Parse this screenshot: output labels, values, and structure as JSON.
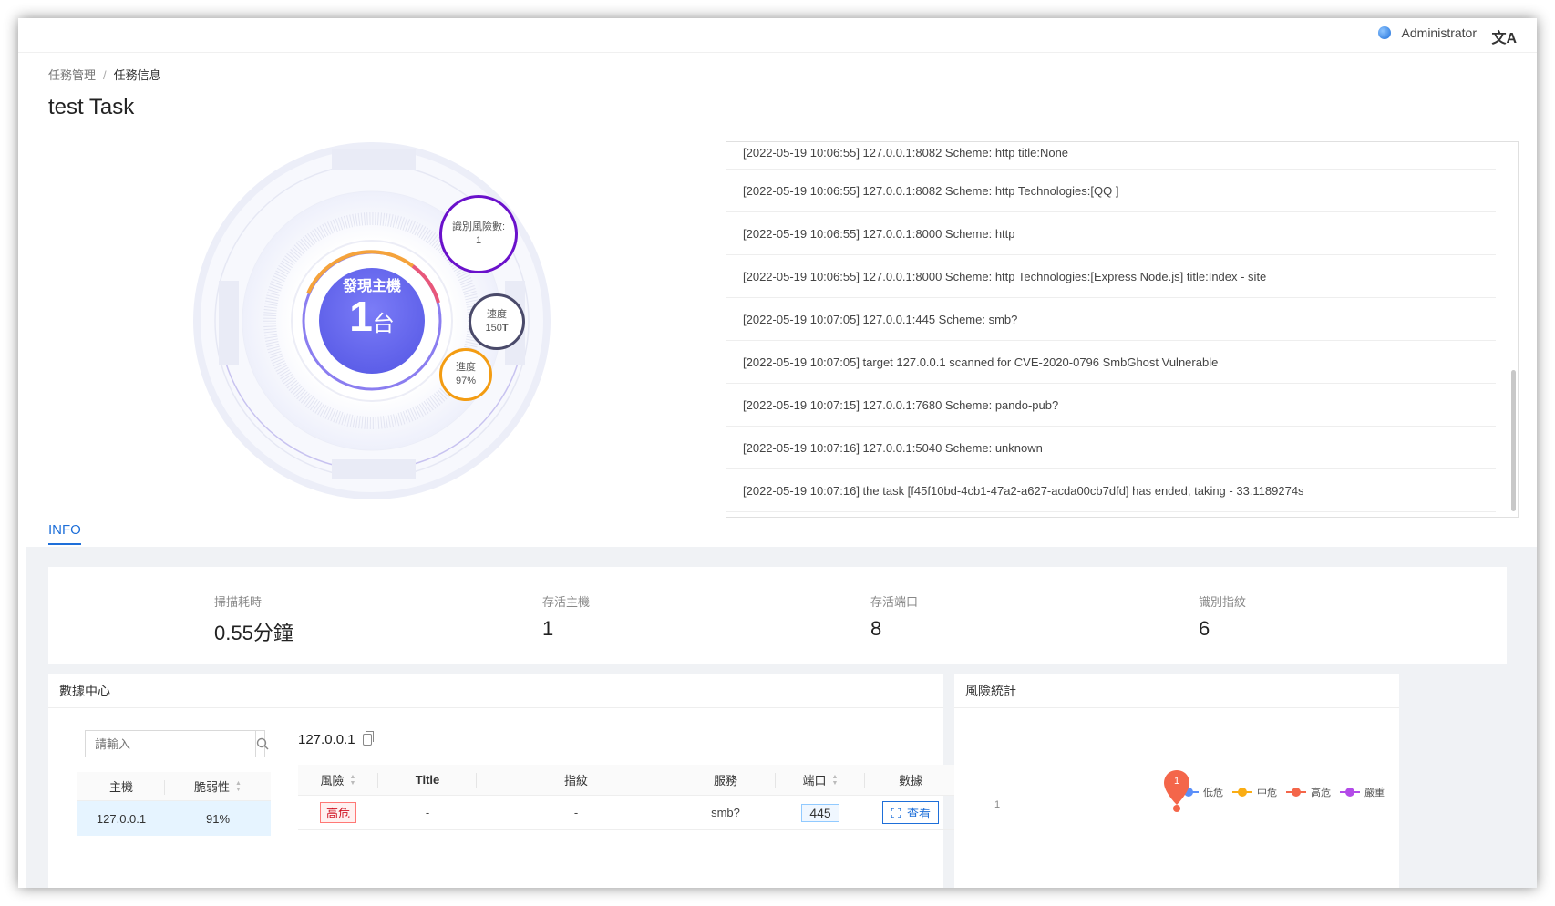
{
  "header": {
    "user": "Administrator",
    "lang_icon": "translate-icon"
  },
  "breadcrumb": {
    "parent": "任務管理",
    "separator": "/",
    "current": "任務信息"
  },
  "page_title": "test Task",
  "gauge": {
    "center_label": "發現主機",
    "center_value": "1",
    "center_unit": "台",
    "risk_label": "識別風險數:",
    "risk_value": "1",
    "speed_label": "速度",
    "speed_value": "150",
    "speed_unit": "T",
    "progress_label": "進度",
    "progress_value": "97%",
    "progress_fraction": 0.97
  },
  "log_lines": [
    "[2022-05-19 10:06:55] 127.0.0.1:8082 Scheme: http title:None",
    "[2022-05-19 10:06:55] 127.0.0.1:8082 Scheme: http Technologies:[QQ ]",
    "[2022-05-19 10:06:55] 127.0.0.1:8000 Scheme: http",
    "[2022-05-19 10:06:55] 127.0.0.1:8000 Scheme: http Technologies:[Express Node.js] title:Index - site",
    "[2022-05-19 10:07:05] 127.0.0.1:445 Scheme: smb?",
    "[2022-05-19 10:07:05] target 127.0.0.1 scanned for CVE-2020-0796 SmbGhost Vulnerable",
    "[2022-05-19 10:07:15] 127.0.0.1:7680 Scheme: pando-pub?",
    "[2022-05-19 10:07:16] 127.0.0.1:5040 Scheme: unknown",
    "[2022-05-19 10:07:16] the task [f45f10bd-4cb1-47a2-a627-acda00cb7dfd] has ended, taking - 33.1189274s"
  ],
  "tabs": {
    "info": "INFO"
  },
  "stats": [
    {
      "label": "掃描耗時",
      "value": "0.55分鐘"
    },
    {
      "label": "存活主機",
      "value": "1"
    },
    {
      "label": "存活端口",
      "value": "8"
    },
    {
      "label": "識別指紋",
      "value": "6"
    }
  ],
  "data_center": {
    "title": "數據中心",
    "search_placeholder": "請輸入",
    "host_columns": [
      "主機",
      "脆弱性"
    ],
    "hosts": [
      {
        "host": "127.0.0.1",
        "vuln": "91%"
      }
    ],
    "selected_ip": "127.0.0.1",
    "vuln_columns": [
      "風險",
      "Title",
      "指紋",
      "服務",
      "端口",
      "數據"
    ],
    "vulns": [
      {
        "risk": "高危",
        "title": "-",
        "fingerprint": "-",
        "service": "smb?",
        "port": "445",
        "action": "查看"
      }
    ]
  },
  "risk_stats": {
    "title": "風險統計",
    "legend": [
      {
        "name": "低危",
        "color": "#5b8ff9"
      },
      {
        "name": "中危",
        "color": "#faad14"
      },
      {
        "name": "高危",
        "color": "#f4664a"
      },
      {
        "name": "嚴重",
        "color": "#b34be8"
      }
    ],
    "y_tick": "1",
    "marker_value": "1"
  },
  "colors": {
    "accent": "#1e6fd9",
    "gauge_center": "#6b6cf0",
    "risk_ring": "#6a11cb",
    "progress_ring": "#f39c12",
    "speed_ring": "#4a4a6a"
  }
}
